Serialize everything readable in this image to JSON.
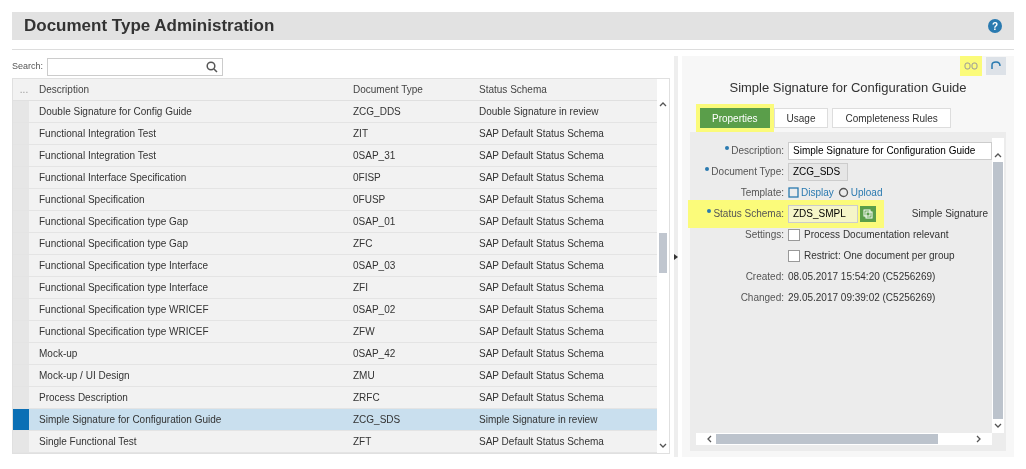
{
  "header": {
    "title": "Document Type Administration",
    "help_icon_label": "?"
  },
  "search": {
    "label": "Search:"
  },
  "table": {
    "columns": [
      "Description",
      "Document Type",
      "Status Schema"
    ],
    "corner": "...",
    "rows": [
      {
        "description": "Double Signature for Config Guide",
        "document_type": "ZCG_DDS",
        "status_schema": "Double Signature in review",
        "selected": false
      },
      {
        "description": "Functional Integration Test",
        "document_type": "ZIT",
        "status_schema": "SAP Default Status Schema",
        "selected": false
      },
      {
        "description": "Functional Integration Test",
        "document_type": "0SAP_31",
        "status_schema": "SAP Default Status Schema",
        "selected": false
      },
      {
        "description": "Functional Interface Specification",
        "document_type": "0FISP",
        "status_schema": "SAP Default Status Schema",
        "selected": false
      },
      {
        "description": "Functional Specification",
        "document_type": "0FUSP",
        "status_schema": "SAP Default Status Schema",
        "selected": false
      },
      {
        "description": "Functional Specification type Gap",
        "document_type": "0SAP_01",
        "status_schema": "SAP Default Status Schema",
        "selected": false
      },
      {
        "description": "Functional Specification type Gap",
        "document_type": "ZFC",
        "status_schema": "SAP Default Status Schema",
        "selected": false
      },
      {
        "description": "Functional Specification type Interface",
        "document_type": "0SAP_03",
        "status_schema": "SAP Default Status Schema",
        "selected": false
      },
      {
        "description": "Functional Specification type Interface",
        "document_type": "ZFI",
        "status_schema": "SAP Default Status Schema",
        "selected": false
      },
      {
        "description": "Functional Specification type WRICEF",
        "document_type": "0SAP_02",
        "status_schema": "SAP Default Status Schema",
        "selected": false
      },
      {
        "description": "Functional Specification type WRICEF",
        "document_type": "ZFW",
        "status_schema": "SAP Default Status Schema",
        "selected": false
      },
      {
        "description": "Mock-up",
        "document_type": "0SAP_42",
        "status_schema": "SAP Default Status Schema",
        "selected": false
      },
      {
        "description": "Mock-up / UI Design",
        "document_type": "ZMU",
        "status_schema": "SAP Default Status Schema",
        "selected": false
      },
      {
        "description": "Process Description",
        "document_type": "ZRFC",
        "status_schema": "SAP Default Status Schema",
        "selected": false
      },
      {
        "description": "Simple Signature for Configuration Guide",
        "document_type": "ZCG_SDS",
        "status_schema": "Simple Signature in review",
        "selected": true
      },
      {
        "description": "Single Functional Test",
        "document_type": "ZFT",
        "status_schema": "SAP Default Status Schema",
        "selected": false
      }
    ]
  },
  "detail": {
    "title": "Simple Signature for Configuration Guide",
    "tabs": [
      {
        "label": "Properties",
        "selected": true
      },
      {
        "label": "Usage",
        "selected": false
      },
      {
        "label": "Completeness Rules",
        "selected": false
      }
    ],
    "fields": [
      {
        "kind": "input",
        "label": "Description:",
        "required": true,
        "value": "Simple Signature for Configuration Guide"
      },
      {
        "kind": "readonly",
        "label": "Document Type:",
        "required": true,
        "value": "ZCG_SDS"
      },
      {
        "kind": "links",
        "label": "Template:",
        "required": false,
        "links": [
          "Display",
          "Upload"
        ]
      },
      {
        "kind": "schema",
        "label": "Status Schema:",
        "required": true,
        "value": "ZDS_SMPL",
        "note": "Simple Signature"
      },
      {
        "kind": "checkbox",
        "label": "Settings:",
        "required": false,
        "text": "Process Documentation relevant",
        "checked": false
      },
      {
        "kind": "checkbox",
        "required": false,
        "text": "Restrict: One document per group",
        "checked": false
      },
      {
        "kind": "text",
        "label": "Created:",
        "required": false,
        "value": "08.05.2017 15:54:20 (C5256269)"
      },
      {
        "kind": "text",
        "label": "Changed:",
        "required": false,
        "value": "29.05.2017 09:39:02 (C5256269)"
      }
    ]
  }
}
